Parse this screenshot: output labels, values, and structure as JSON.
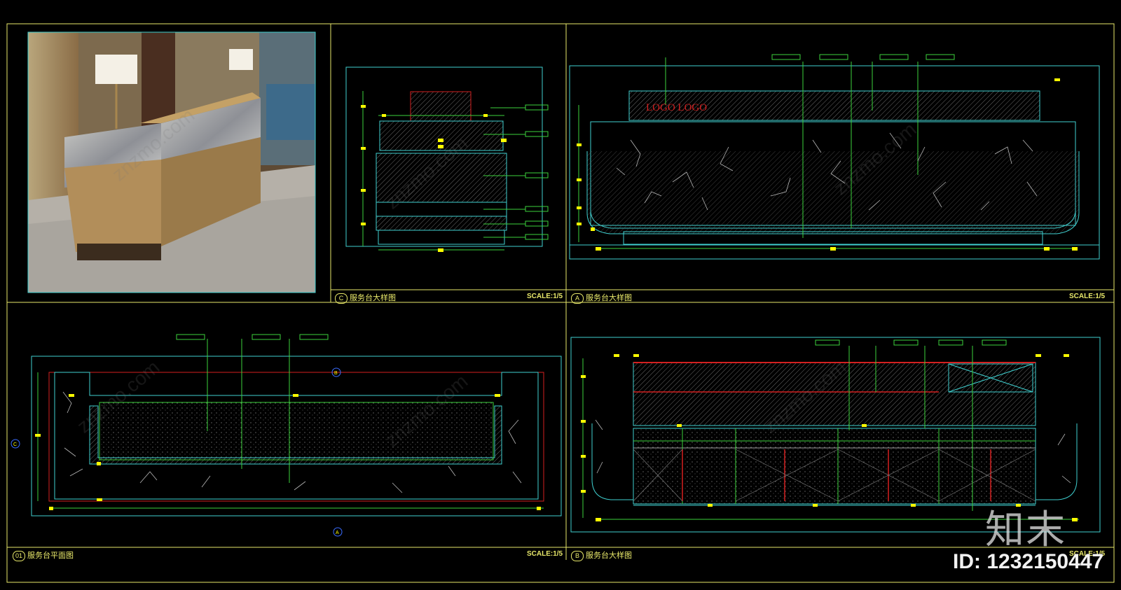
{
  "panels": {
    "photo": {},
    "section_c": {
      "marker": "C",
      "title": "服务台大样图",
      "scale": "SCALE:1/5"
    },
    "elevation_a": {
      "marker": "A",
      "title": "服务台大样图",
      "scale": "SCALE:1/5",
      "logo_text": "LOGO LOGO"
    },
    "plan_01": {
      "marker": "01",
      "title": "服务台平面图",
      "scale": "SCALE:1/5"
    },
    "elevation_b": {
      "marker": "B",
      "title": "服务台大样图",
      "scale": "SCALE:1/5"
    }
  },
  "watermark": {
    "logo": "知末",
    "id_text": "ID: 1232150447"
  },
  "colors": {
    "frame": "#e8e86a",
    "cyan": "#3fd0d0",
    "green": "#3cd23c",
    "red": "#d42020",
    "tag_yellow": "#ffff00"
  }
}
